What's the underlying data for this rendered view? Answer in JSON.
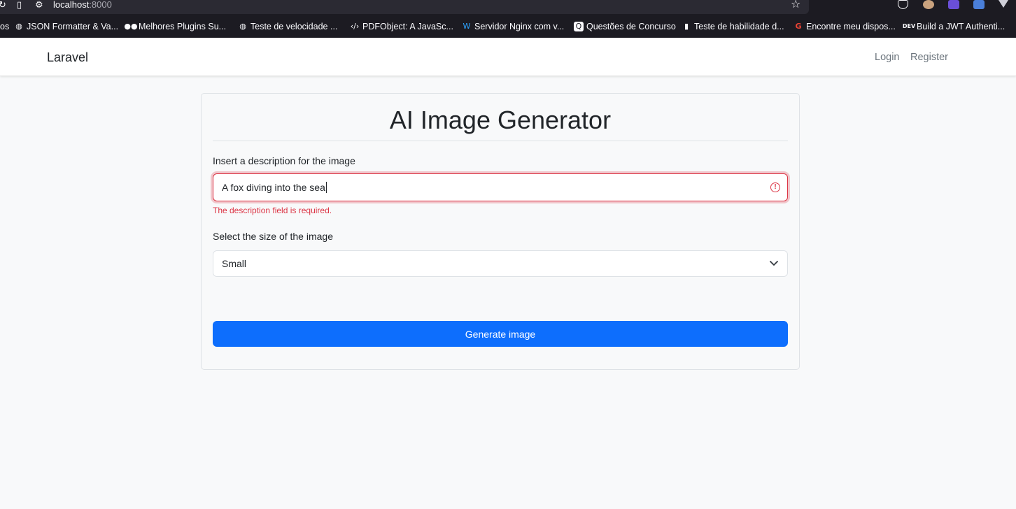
{
  "browser": {
    "url_host": "localhost",
    "url_port": ":8000",
    "bookmarks": [
      {
        "icon": "globe-icon",
        "label": "JSON Formatter & Va..."
      },
      {
        "icon": "medium-icon",
        "label": "Melhores Plugins Su..."
      },
      {
        "icon": "globe-icon",
        "label": "Teste de velocidade ..."
      },
      {
        "icon": "code-icon",
        "label": "PDFObject: A JavaSc..."
      },
      {
        "icon": "wave-icon",
        "label": "Servidor Nginx com v..."
      },
      {
        "icon": "chat-icon",
        "label": "Questões de Concurso"
      },
      {
        "icon": "bars-icon",
        "label": "Teste de habilidade d..."
      },
      {
        "icon": "google-icon",
        "label": "Encontre meu dispos..."
      },
      {
        "icon": "dev-icon",
        "label": "Build a JWT Authenti..."
      }
    ],
    "partial_bookmark": "os"
  },
  "navbar": {
    "brand": "Laravel",
    "login": "Login",
    "register": "Register"
  },
  "form": {
    "title": "AI Image Generator",
    "description_label": "Insert a description for the image",
    "description_value": "A fox diving into the sea",
    "description_error": "The description field is required.",
    "size_label": "Select the size of the image",
    "size_selected": "Small",
    "submit_label": "Generate image"
  },
  "colors": {
    "primary": "#0d6efd",
    "danger": "#dc3545",
    "background": "#f8f9fa"
  }
}
